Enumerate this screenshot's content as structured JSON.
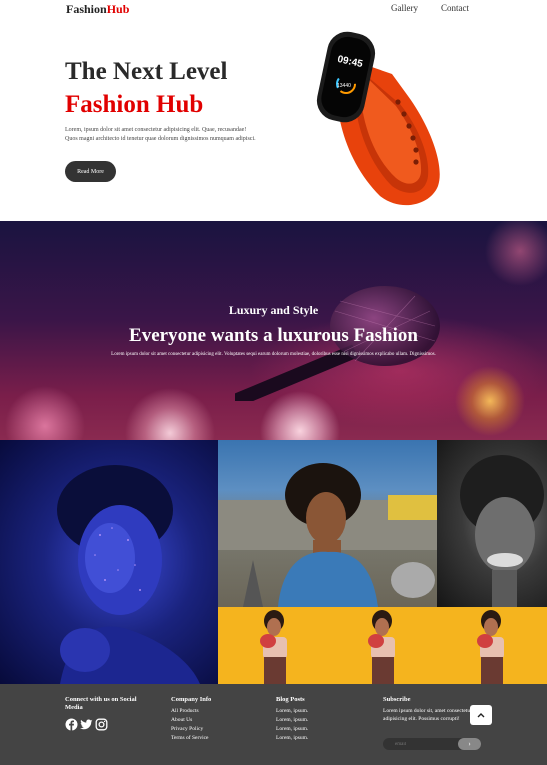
{
  "nav": {
    "logo_main": "Fashion",
    "logo_accent": "Hub",
    "links": [
      "Gallery",
      "Contact"
    ]
  },
  "hero": {
    "title_line1": "The Next Level",
    "title_line2": "Fashion Hub",
    "paragraph": "Lorem, ipsum dolor sit amet consectetur adipisicing elit. Quae, recusandae! Quos magni architecto id tenetur quae dolorum dignissimos numquam adipisci.",
    "button": "Read More",
    "watch_time": "09:45",
    "watch_steps": "13440"
  },
  "banner": {
    "subtitle": "Luxury and Style",
    "title": "Everyone wants a luxurous Fashion",
    "paragraph": "Lorem ipsum dolor sit amet consectetur adipisicing elit. Voluptates sequi earum dolorum molestiae, doloribus esse nisi dignissimos explicabo ullam. Dignissimos."
  },
  "footer": {
    "social_heading": "Connect with us on Social Media",
    "company": {
      "heading": "Company Info",
      "items": [
        "All Products",
        "About Us",
        "Privacy Policy",
        "Terms of Service"
      ]
    },
    "blog": {
      "heading": "Blog Posts",
      "items": [
        "Lorem, ipsum.",
        "Lorem, ipsum.",
        "Lorem, ipsum.",
        "Lorem, ipsum."
      ]
    },
    "subscribe": {
      "heading": "Subscribe",
      "text": "Lorem ipsum dolor sit, amet consectetur adipisicing elit. Possimus corrupti!",
      "placeholder": "email",
      "button": "›"
    },
    "social_icons": [
      "facebook-icon",
      "twitter-icon",
      "instagram-icon"
    ]
  },
  "colors": {
    "accent": "#e10000",
    "dark": "#333333",
    "footer_bg": "#444444",
    "watch_band": "#e8420c"
  }
}
